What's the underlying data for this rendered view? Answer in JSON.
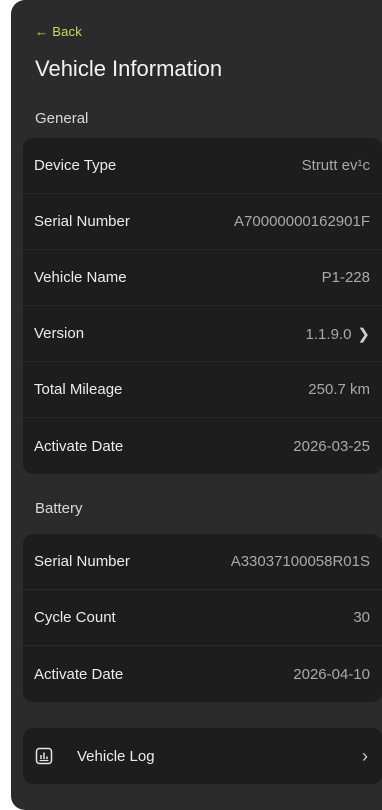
{
  "header": {
    "back_label": "Back",
    "title": "Vehicle Information"
  },
  "general": {
    "section_label": "General",
    "rows": [
      {
        "label": "Device Type",
        "value": "Strutt ev¹c"
      },
      {
        "label": "Serial Number",
        "value": "A70000000162901F"
      },
      {
        "label": "Vehicle Name",
        "value": "P1-228"
      },
      {
        "label": "Version",
        "value": "1.1.9.0"
      },
      {
        "label": "Total Mileage",
        "value": "250.7 km"
      },
      {
        "label": "Activate Date",
        "value": "2026-03-25"
      }
    ]
  },
  "battery": {
    "section_label": "Battery",
    "rows": [
      {
        "label": "Serial Number",
        "value": "A33037100058R01S"
      },
      {
        "label": "Cycle Count",
        "value": "30"
      },
      {
        "label": "Activate Date",
        "value": "2026-04-10"
      }
    ]
  },
  "log": {
    "label": "Vehicle Log",
    "icon": "chart-log-icon"
  },
  "colors": {
    "accent": "#c9dd5a",
    "panel_bg": "#2b2b2b",
    "card_bg": "#1d1d1d"
  }
}
